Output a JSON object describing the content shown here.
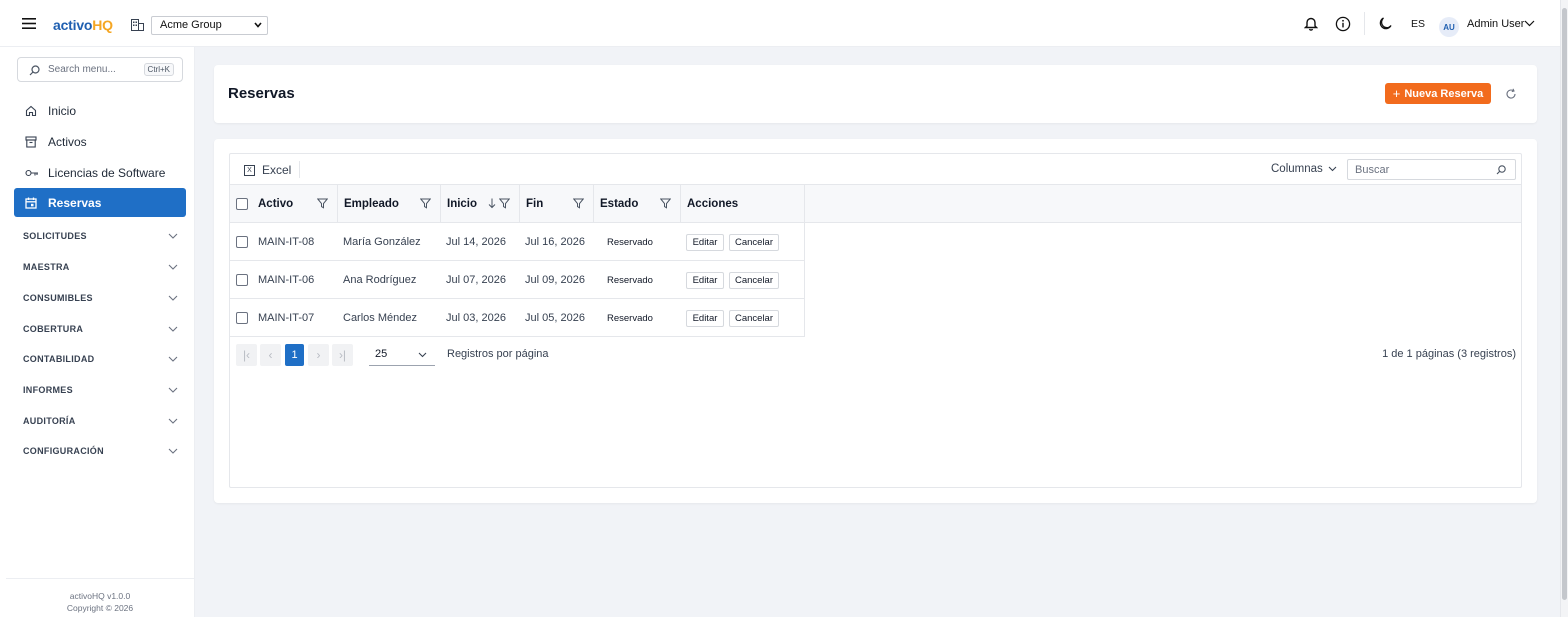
{
  "app": {
    "logo_part1": "activo",
    "logo_part2": "HQ",
    "org_selected": "Acme Group",
    "language": "ES",
    "user_initials": "AU",
    "user_name": "Admin User"
  },
  "sidebar": {
    "search_placeholder": "Search menu...",
    "search_shortcut": "Ctrl+K",
    "items": [
      {
        "label": "Inicio",
        "icon": "home-icon"
      },
      {
        "label": "Activos",
        "icon": "archive-icon"
      },
      {
        "label": "Licencias de Software",
        "icon": "key-icon"
      },
      {
        "label": "Reservas",
        "icon": "calendar-icon",
        "active": true
      }
    ],
    "sections": [
      "SOLICITUDES",
      "MAESTRA",
      "CONSUMIBLES",
      "COBERTURA",
      "CONTABILIDAD",
      "INFORMES",
      "AUDITORÍA",
      "CONFIGURACIÓN"
    ],
    "footer_version": "activoHQ v1.0.0",
    "footer_copyright": "Copyright © 2026"
  },
  "page": {
    "title": "Reservas",
    "new_button": "Nueva Reserva"
  },
  "grid": {
    "export_label": "Excel",
    "columns_label": "Columnas",
    "search_placeholder": "Buscar",
    "headers": [
      "Activo",
      "Empleado",
      "Inicio",
      "Fin",
      "Estado",
      "Acciones"
    ],
    "rows": [
      {
        "activo": "MAIN-IT-08",
        "empleado": "María González",
        "inicio": "Jul 14, 2026",
        "fin": "Jul 16, 2026",
        "estado": "Reservado"
      },
      {
        "activo": "MAIN-IT-06",
        "empleado": "Ana Rodríguez",
        "inicio": "Jul 07, 2026",
        "fin": "Jul 09, 2026",
        "estado": "Reservado"
      },
      {
        "activo": "MAIN-IT-07",
        "empleado": "Carlos Méndez",
        "inicio": "Jul 03, 2026",
        "fin": "Jul 05, 2026",
        "estado": "Reservado"
      }
    ],
    "edit_label": "Editar",
    "cancel_label": "Cancelar",
    "pager": {
      "current_page": "1",
      "page_size": "25",
      "per_page_label": "Registros por página",
      "info": "1 de 1 páginas (3 registros)"
    }
  },
  "colors": {
    "primary": "#1f6fc6",
    "accent": "#f26b1d",
    "logo_highlight": "#f5a623"
  }
}
